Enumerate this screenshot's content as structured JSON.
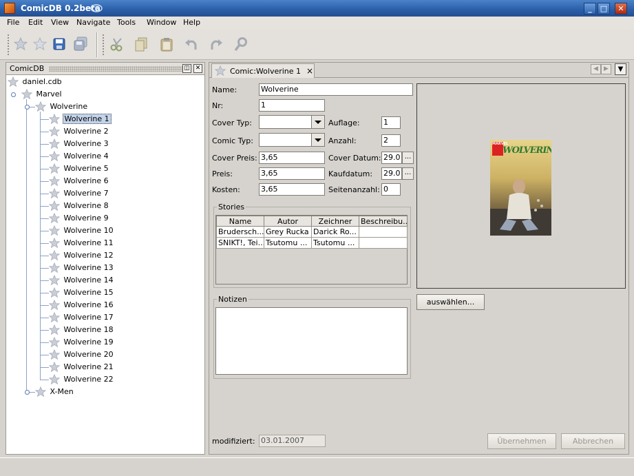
{
  "window": {
    "title": "ComicDB 0.2beta",
    "minimize": "_",
    "maximize": "□",
    "close": "✕"
  },
  "menu": {
    "items": [
      {
        "label": "File"
      },
      {
        "label": "Edit"
      },
      {
        "label": "View"
      },
      {
        "label": "Navigate"
      },
      {
        "label": "Tools"
      },
      {
        "label": "Window"
      },
      {
        "label": "Help"
      }
    ]
  },
  "toolbar": {
    "icons": [
      "star-icon",
      "star-outline-icon",
      "save-icon",
      "save-all-icon",
      "cut-icon",
      "copy-icon",
      "paste-icon",
      "undo-icon",
      "redo-icon",
      "search-icon"
    ]
  },
  "leftpanel": {
    "title": "ComicDB",
    "tree": {
      "root": "daniel.cdb",
      "publisher": "Marvel",
      "series": "Wolverine",
      "issues": [
        "Wolverine 1",
        "Wolverine 2",
        "Wolverine 3",
        "Wolverine 4",
        "Wolverine 5",
        "Wolverine 6",
        "Wolverine 7",
        "Wolverine 8",
        "Wolverine 9",
        "Wolverine 10",
        "Wolverine 11",
        "Wolverine 12",
        "Wolverine 13",
        "Wolverine 14",
        "Wolverine 15",
        "Wolverine 16",
        "Wolverine 17",
        "Wolverine 18",
        "Wolverine 19",
        "Wolverine 20",
        "Wolverine 21",
        "Wolverine 22"
      ],
      "selected": "Wolverine 1",
      "other_series": "X-Men"
    }
  },
  "editor": {
    "tab_label": "Comic:Wolverine 1",
    "tab_close": "×",
    "labels": {
      "name": "Name:",
      "nr": "Nr:",
      "cover_typ": "Cover Typ:",
      "comic_typ": "Comic Typ:",
      "cover_preis": "Cover Preis:",
      "preis": "Preis:",
      "kosten": "Kosten:",
      "auflage": "Auflage:",
      "anzahl": "Anzahl:",
      "cover_datum": "Cover Datum:",
      "kaufdatum": "Kaufdatum:",
      "seitenanzahl": "Seitenanzahl:",
      "stories": "Stories",
      "notizen": "Notizen",
      "modifiziert": "modifiziert:"
    },
    "values": {
      "name": "Wolverine",
      "nr": "1",
      "cover_typ": "",
      "comic_typ": "",
      "cover_preis": "3,65",
      "preis": "3,65",
      "kosten": "3,65",
      "auflage": "1",
      "anzahl": "2",
      "cover_datum": "29.0",
      "kaufdatum": "29.0",
      "seitenanzahl": "0",
      "modifiziert": "03.01.2007",
      "notizen": ""
    },
    "date_button": "...",
    "stories": {
      "columns": [
        "Name",
        "Autor",
        "Zeichner",
        "Beschreibu..."
      ],
      "rows": [
        [
          "Brudersch...",
          "Grey Rucka",
          "Darick Ro...",
          ""
        ],
        [
          "SNIKT!, Tei...",
          "Tsutomu ...",
          "Tsutomu ...",
          ""
        ]
      ]
    },
    "cover_image": {
      "title_art": "WOLVERINE",
      "logo": "MARVEL"
    },
    "buttons": {
      "select": "auswählen...",
      "apply": "Übernehmen",
      "cancel": "Abbrechen"
    }
  }
}
